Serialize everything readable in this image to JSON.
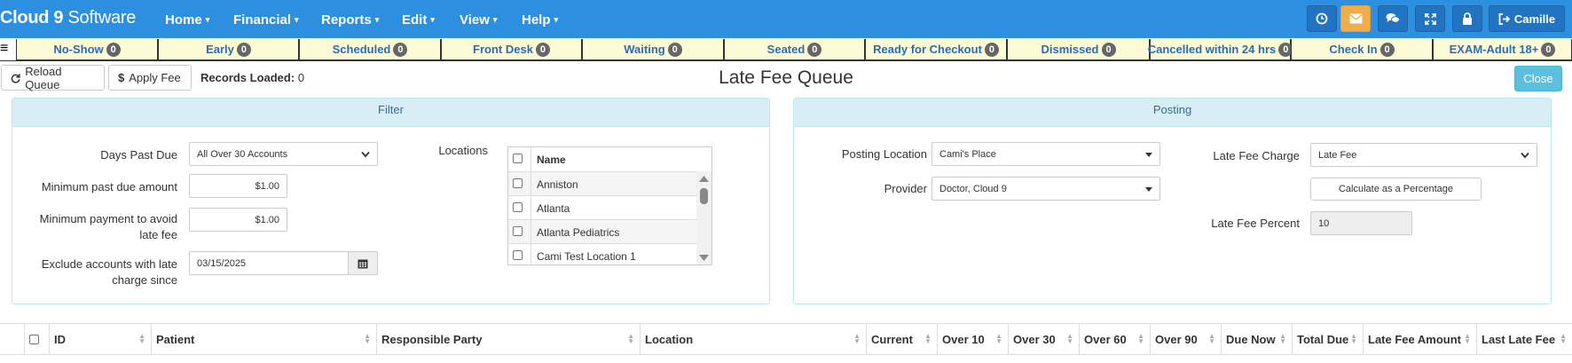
{
  "brand": {
    "bold": "Cloud 9",
    "soft": "Software"
  },
  "menu": [
    {
      "label": "Home",
      "caret": "▾"
    },
    {
      "label": "Financial",
      "caret": "▾"
    },
    {
      "label": "Reports",
      "caret": "▾"
    },
    {
      "label": "Edit",
      "caret": "▾"
    },
    {
      "label": "View",
      "caret": "▾"
    },
    {
      "label": "Help",
      "caret": "▾"
    }
  ],
  "nav_buttons": {
    "user": "Camille"
  },
  "status_tabs": [
    {
      "label": "No-Show",
      "count": "0"
    },
    {
      "label": "Early",
      "count": "0"
    },
    {
      "label": "Scheduled",
      "count": "0"
    },
    {
      "label": "Front Desk",
      "count": "0"
    },
    {
      "label": "Waiting",
      "count": "0"
    },
    {
      "label": "Seated",
      "count": "0"
    },
    {
      "label": "Ready for Checkout",
      "count": "0"
    },
    {
      "label": "Dismissed",
      "count": "0"
    },
    {
      "label": "Cancelled within 24 hrs",
      "count": "0"
    },
    {
      "label": "Check In",
      "count": "0"
    },
    {
      "label": "EXAM-Adult 18+",
      "count": "0"
    }
  ],
  "toolbar": {
    "reload": "Reload Queue",
    "apply_fee": "Apply Fee",
    "records_label": "Records Loaded:",
    "records_count": "0"
  },
  "page_title": "Late Fee Queue",
  "close_label": "Close",
  "filter": {
    "title": "Filter",
    "days_past_due_label": "Days Past Due",
    "days_past_due_value": "All Over 30 Accounts",
    "min_past_due_label": "Minimum past due amount",
    "min_past_due_value": "$1.00",
    "min_payment_label_1": "Minimum payment to avoid",
    "min_payment_label_2": "late fee",
    "min_payment_value": "$1.00",
    "exclude_label_1": "Exclude accounts with late",
    "exclude_label_2": "charge since",
    "exclude_value": "03/15/2025",
    "locations_label": "Locations",
    "locations_header": "Name",
    "locations": [
      "Anniston",
      "Atlanta",
      "Atlanta Pediatrics",
      "Cami Test Location 1"
    ]
  },
  "posting": {
    "title": "Posting",
    "location_label": "Posting Location",
    "location_value": "Cami's Place",
    "provider_label": "Provider",
    "provider_value": "Doctor, Cloud 9",
    "late_fee_charge_label": "Late Fee Charge",
    "late_fee_charge_value": "Late Fee",
    "calc_button": "Calculate as a Percentage",
    "late_fee_percent_label": "Late Fee Percent",
    "late_fee_percent_value": "10"
  },
  "table_headers": [
    "ID",
    "Patient",
    "Responsible Party",
    "Location",
    "Current",
    "Over 10",
    "Over 30",
    "Over 60",
    "Over 90",
    "Due Now",
    "Total Due",
    "Late Fee Amount",
    "Last Late Fee"
  ],
  "colors": {
    "nav": "#2c8fdf",
    "tab_bg": "#fcfbd6",
    "tab_text": "#2a6db5",
    "panel_head": "#d9edf7",
    "close": "#5bc0de",
    "mail": "#f0ad4e"
  }
}
